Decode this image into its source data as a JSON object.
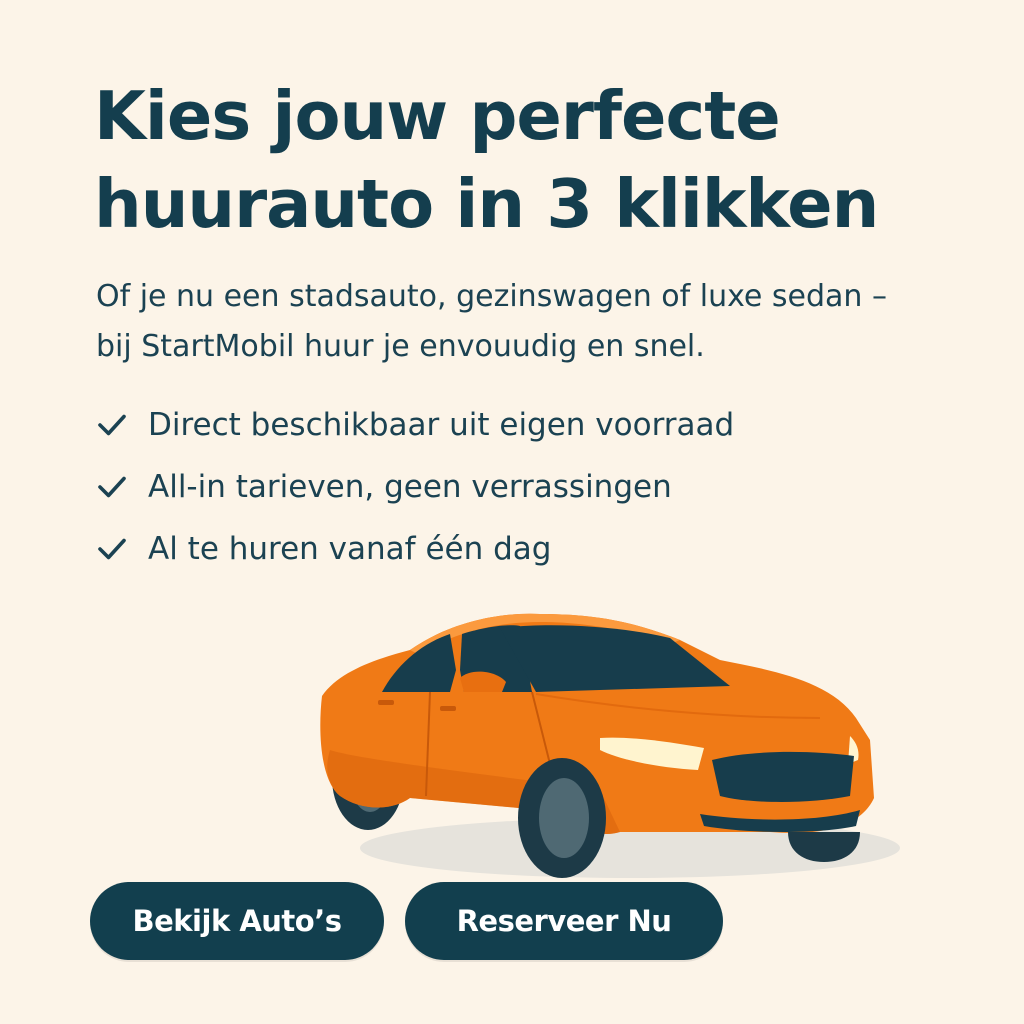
{
  "hero": {
    "headline_line1": "Kies jouw perfecte",
    "headline_line2": "huurauto in 3 klikken",
    "subtitle_line1": "Of je nu een stadsauto, gezinswagen of luxe sedan –",
    "subtitle_line2": "bij StartMobil huur je envouudig en snel."
  },
  "features": [
    {
      "icon": "check-icon",
      "label": "Direct beschikbaar uit eigen voorraad"
    },
    {
      "icon": "check-icon",
      "label": "All-in tarieven, geen verrassingen"
    },
    {
      "icon": "check-icon",
      "label": "Al te huren vanaf één dag"
    }
  ],
  "illustration": {
    "icon": "orange-sedan-car",
    "car_color": "#f07a16"
  },
  "buttons": {
    "view_cars_label": "Bekijk Auto’s",
    "reserve_label": "Reserveer Nu"
  },
  "colors": {
    "background": "#fcf4e8",
    "text_primary": "#143e4e",
    "button_bg": "#123f4e",
    "button_text": "#ffffff",
    "accent_orange": "#f07a16"
  }
}
